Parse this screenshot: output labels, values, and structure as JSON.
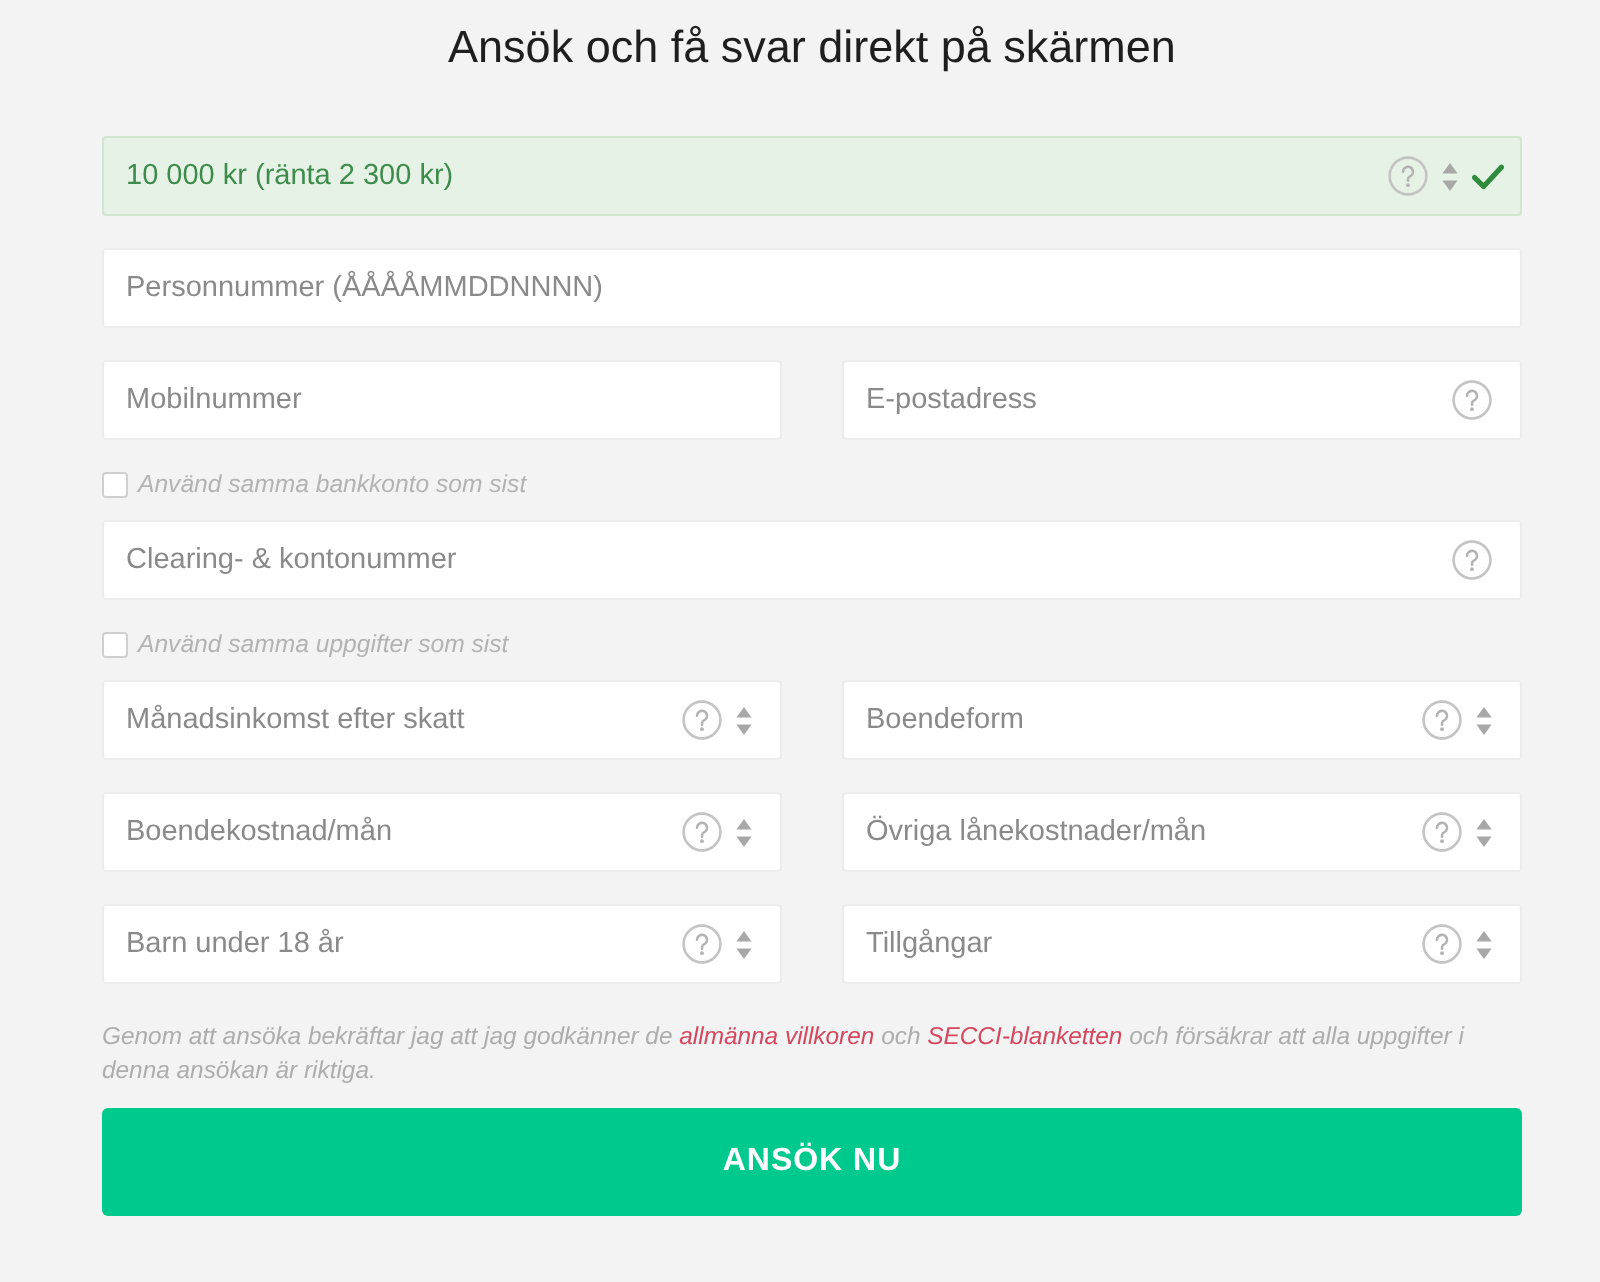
{
  "title": "Ansök och få svar direkt på skärmen",
  "form": {
    "rows": [
      {
        "kind": "fields",
        "fields": [
          {
            "kind": "select",
            "value": "10 000 kr (ränta 2 300 kr)",
            "valid": true
          }
        ]
      },
      {
        "kind": "fields",
        "fields": [
          {
            "kind": "plain",
            "placeholder": "Personnummer (ÅÅÅÅMMDDNNNN)",
            "valid": false
          }
        ]
      },
      {
        "kind": "fields",
        "fields": [
          {
            "kind": "plain",
            "placeholder": "Mobilnummer",
            "valid": false
          },
          {
            "kind": "help",
            "placeholder": "E-postadress",
            "valid": false
          }
        ]
      },
      {
        "kind": "checkbox",
        "label": "Använd samma bankkonto som sist",
        "checked": false
      },
      {
        "kind": "fields",
        "fields": [
          {
            "kind": "help",
            "placeholder": "Clearing- & kontonummer",
            "valid": false
          }
        ]
      },
      {
        "kind": "checkbox",
        "label": "Använd samma uppgifter som sist",
        "checked": false
      },
      {
        "kind": "fields",
        "fields": [
          {
            "kind": "select",
            "placeholder": "Månadsinkomst efter skatt",
            "valid": false
          },
          {
            "kind": "select",
            "placeholder": "Boendeform",
            "valid": false
          }
        ]
      },
      {
        "kind": "fields",
        "fields": [
          {
            "kind": "select",
            "placeholder": "Boendekostnad/mån",
            "valid": false
          },
          {
            "kind": "select",
            "placeholder": "Övriga lånekostnader/mån",
            "valid": false
          }
        ]
      },
      {
        "kind": "fields",
        "fields": [
          {
            "kind": "select",
            "placeholder": "Barn under 18 år",
            "valid": false
          },
          {
            "kind": "select",
            "placeholder": "Tillgångar",
            "valid": false
          }
        ]
      }
    ]
  },
  "terms": [
    {
      "kind": "text",
      "text": "Genom att ansöka bekräftar jag att jag godkänner de "
    },
    {
      "kind": "link",
      "text": "allmänna villkoren"
    },
    {
      "kind": "text",
      "text": " och "
    },
    {
      "kind": "link",
      "text": "SECCI-blanketten"
    },
    {
      "kind": "text",
      "text": " och försäkrar att alla uppgifter i denna ansökan är riktiga."
    }
  ],
  "submit": {
    "label": "ANSÖK NU"
  }
}
